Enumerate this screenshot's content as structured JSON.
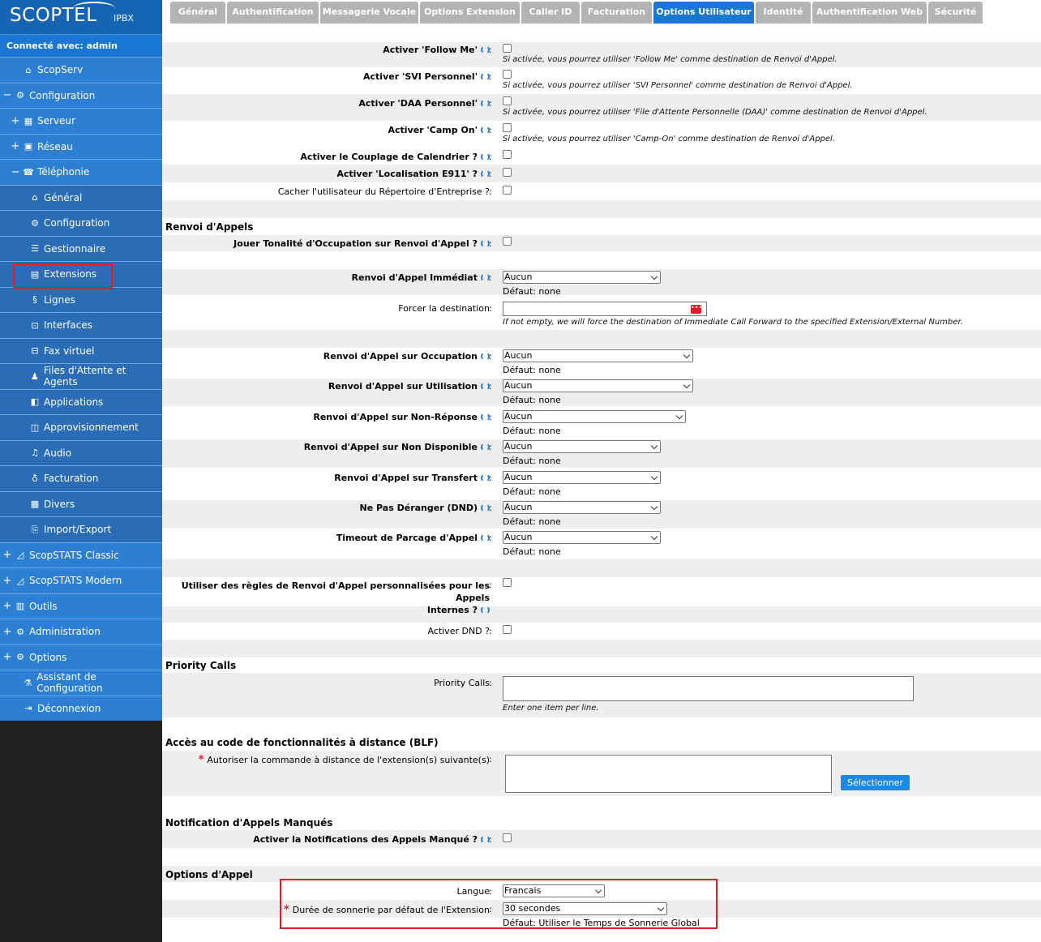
{
  "logo": {
    "brand": "SCOPTEL",
    "sub": "IPBX"
  },
  "connected": "Connecté avec: admin",
  "sidebar": [
    {
      "label": "ScopServ",
      "pm": "",
      "icon": "home-icon",
      "glyph": "⌂",
      "lvl": "l1"
    },
    {
      "label": "Configuration",
      "pm": "−",
      "icon": "gear-icon",
      "glyph": "⚙",
      "lvl": "l0"
    },
    {
      "label": "Serveur",
      "pm": "+",
      "icon": "server-icon",
      "glyph": "▦",
      "lvl": "l1"
    },
    {
      "label": "Réseau",
      "pm": "+",
      "icon": "network-icon",
      "glyph": "▣",
      "lvl": "l1"
    },
    {
      "label": "Téléphonie",
      "pm": "−",
      "icon": "phone-icon",
      "glyph": "☎",
      "lvl": "l1"
    },
    {
      "label": "Général",
      "pm": "",
      "icon": "home-icon",
      "glyph": "⌂",
      "lvl": "l2"
    },
    {
      "label": "Configuration",
      "pm": "",
      "icon": "gear-icon",
      "glyph": "⚙",
      "lvl": "l2"
    },
    {
      "label": "Gestionnaire",
      "pm": "",
      "icon": "list-icon",
      "glyph": "☰",
      "lvl": "l2"
    },
    {
      "label": "Extensions",
      "pm": "",
      "icon": "extensions-icon",
      "glyph": "▤",
      "lvl": "l2"
    },
    {
      "label": "Lignes",
      "pm": "",
      "icon": "lines-icon",
      "glyph": "§",
      "lvl": "l2"
    },
    {
      "label": "Interfaces",
      "pm": "",
      "icon": "interfaces-icon",
      "glyph": "⊡",
      "lvl": "l2"
    },
    {
      "label": "Fax virtuel",
      "pm": "",
      "icon": "fax-icon",
      "glyph": "⊟",
      "lvl": "l2"
    },
    {
      "label": "Files d'Attente et Agents",
      "pm": "",
      "icon": "user-icon",
      "glyph": "♟",
      "lvl": "l2"
    },
    {
      "label": "Applications",
      "pm": "",
      "icon": "applications-icon",
      "glyph": "◧",
      "lvl": "l2"
    },
    {
      "label": "Approvisionnement",
      "pm": "",
      "icon": "provisioning-icon",
      "glyph": "◫",
      "lvl": "l2"
    },
    {
      "label": "Audio",
      "pm": "",
      "icon": "music-icon",
      "glyph": "♫",
      "lvl": "l2"
    },
    {
      "label": "Facturation",
      "pm": "",
      "icon": "money-bag-icon",
      "glyph": "♁",
      "lvl": "l2"
    },
    {
      "label": "Divers",
      "pm": "",
      "icon": "grid-icon",
      "glyph": "▩",
      "lvl": "l2"
    },
    {
      "label": "Import/Export",
      "pm": "",
      "icon": "file-icon",
      "glyph": "⎘",
      "lvl": "l2"
    },
    {
      "label": "ScopSTATS Classic",
      "pm": "+",
      "icon": "chart-icon",
      "glyph": "◿",
      "lvl": "l0"
    },
    {
      "label": "ScopSTATS Modern",
      "pm": "+",
      "icon": "chart-icon",
      "glyph": "◿",
      "lvl": "l0"
    },
    {
      "label": "Outils",
      "pm": "+",
      "icon": "tools-icon",
      "glyph": "▥",
      "lvl": "l0"
    },
    {
      "label": "Administration",
      "pm": "+",
      "icon": "admin-gear-icon",
      "glyph": "⚙",
      "lvl": "l0"
    },
    {
      "label": "Options",
      "pm": "+",
      "icon": "gear-icon",
      "glyph": "⚙",
      "lvl": "l0"
    },
    {
      "label": "Assistant de Configuration",
      "pm": "",
      "icon": "wizard-icon",
      "glyph": "⚗",
      "lvl": "l1"
    },
    {
      "label": "Déconnexion",
      "pm": "",
      "icon": "logout-icon",
      "glyph": "⇥",
      "lvl": "l1"
    }
  ],
  "tabs": [
    "Général",
    "Authentification",
    "Messagerie Vocale",
    "Options Extension",
    "Caller ID",
    "Facturation",
    "Options Utilisateur",
    "Identité",
    "Authentification Web",
    "Sécurité"
  ],
  "active_tab": "Options Utilisateur",
  "form": {
    "follow_me": {
      "label": "Activer 'Follow Me'",
      "hint": "Si activée, vous pourrez utiliser 'Follow Me' comme destination de Renvoi d'Appel."
    },
    "svi": {
      "label": "Activer 'SVI Personnel'",
      "hint": "Si activée, vous pourrez utiliser 'SVI Personnel' comme destination de Renvoi d'Appel."
    },
    "daa": {
      "label": "Activer 'DAA Personnel'",
      "hint": "Si activée, vous pourrez utiliser 'File d'Attente Personnelle (DAA)' comme destination de Renvoi d'Appel."
    },
    "camp_on": {
      "label": "Activer 'Camp On'",
      "hint": "Si activée, vous pourrez utiliser 'Camp-On' comme destination de Renvoi d'Appel."
    },
    "calendar": {
      "label": "Activer le Couplage de Calendrier ?"
    },
    "e911": {
      "label": "Activer 'Localisation E911' ?"
    },
    "hide_dir": {
      "label": "Cacher l'utilisateur du Répertoire d'Entreprise ?"
    },
    "sec_forward": "Renvoi d'Appels",
    "busy_tone": {
      "label": "Jouer Tonalité d'Occupation sur Renvoi d'Appel ?"
    },
    "immediate": {
      "label": "Renvoi d'Appel Immédiat",
      "value": "Aucun",
      "default": "Défaut: none"
    },
    "force_dest": {
      "label": "Forcer la destination",
      "hint": "If not empty, we will force the destination of Immediate Call Forward to the specified Extension/External Number."
    },
    "on_busy": {
      "label": "Renvoi d'Appel sur Occupation",
      "value": "Aucun",
      "default": "Défaut: none"
    },
    "on_use": {
      "label": "Renvoi d'Appel sur Utilisation",
      "value": "Aucun",
      "default": "Défaut: none"
    },
    "on_noanswer": {
      "label": "Renvoi d'Appel sur Non-Réponse",
      "value": "Aucun",
      "default": "Défaut: none"
    },
    "on_unavail": {
      "label": "Renvoi d'Appel sur Non Disponible",
      "value": "Aucun",
      "default": "Défaut: none"
    },
    "on_transfer": {
      "label": "Renvoi d'Appel sur Transfert",
      "value": "Aucun",
      "default": "Défaut: none"
    },
    "dnd": {
      "label": "Ne Pas Déranger (DND)",
      "value": "Aucun",
      "default": "Défaut: none"
    },
    "parking": {
      "label": "Timeout de Parcage d'Appel",
      "value": "Aucun",
      "default": "Défaut: none"
    },
    "custom_rules": {
      "label1": "Utiliser des règles de Renvoi d'Appel personnalisées pour les Appels",
      "label2": "Internes ?"
    },
    "activate_dnd": {
      "label": "Activer DND ?"
    },
    "sec_priority": "Priority Calls",
    "priority": {
      "label": "Priority Calls",
      "hint": "Enter one item per line."
    },
    "sec_blf": "Accès au code de fonctionnalités à distance (BLF)",
    "blf": {
      "label": "Autoriser la commande à distance de l'extension(s) suivante(s)",
      "button": "Sélectionner"
    },
    "sec_missed": "Notification d'Appels Manqués",
    "missed": {
      "label": "Activer la Notifications des Appels Manqué ?"
    },
    "sec_options": "Options d'Appel",
    "language": {
      "label": "Langue",
      "value": "Francais"
    },
    "ring": {
      "label": "Durée de sonnerie par défaut de l'Extension",
      "value": "30 secondes",
      "default": "Défaut: Utiliser le Temps de Sonnerie Global"
    }
  }
}
